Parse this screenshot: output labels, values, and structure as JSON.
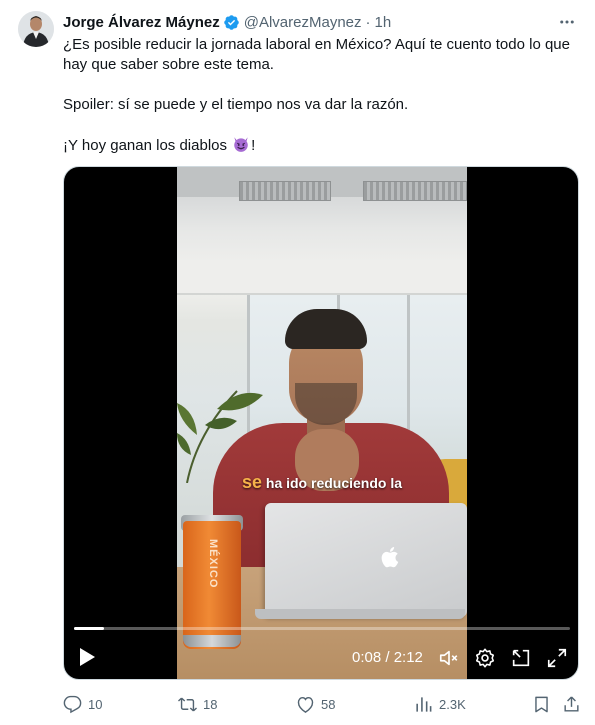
{
  "tweet": {
    "author_name": "Jorge Álvarez Máynez",
    "handle": "@AlvarezMaynez",
    "separator": "·",
    "time": "1h",
    "paragraphs": {
      "p1": "¿Es posible reducir la jornada laboral en México? Aquí te cuento todo lo que hay que saber sobre este tema.",
      "p2": "Spoiler: sí se puede y el tiempo nos va dar la razón.",
      "p3_before": "¡Y hoy ganan los diablos ",
      "p3_after": "!"
    },
    "emoji": "smiling-devil-emoji"
  },
  "video": {
    "caption_highlight": "se",
    "caption_rest": " ha ido reduciendo la",
    "cup_text": "MÉXICO",
    "current_time": "0:08 / 2:12",
    "progress": 0.06,
    "icons": [
      "play-icon",
      "mute-icon",
      "settings-icon",
      "picture-in-picture-icon",
      "fullscreen-icon"
    ]
  },
  "actions": {
    "replies": "10",
    "reposts": "18",
    "likes": "58",
    "views": "2.3K"
  },
  "colors": {
    "text": "#0f1419",
    "muted": "#536471",
    "verified": "#1d9bf0",
    "caption_highlight": "#f6b24a"
  }
}
